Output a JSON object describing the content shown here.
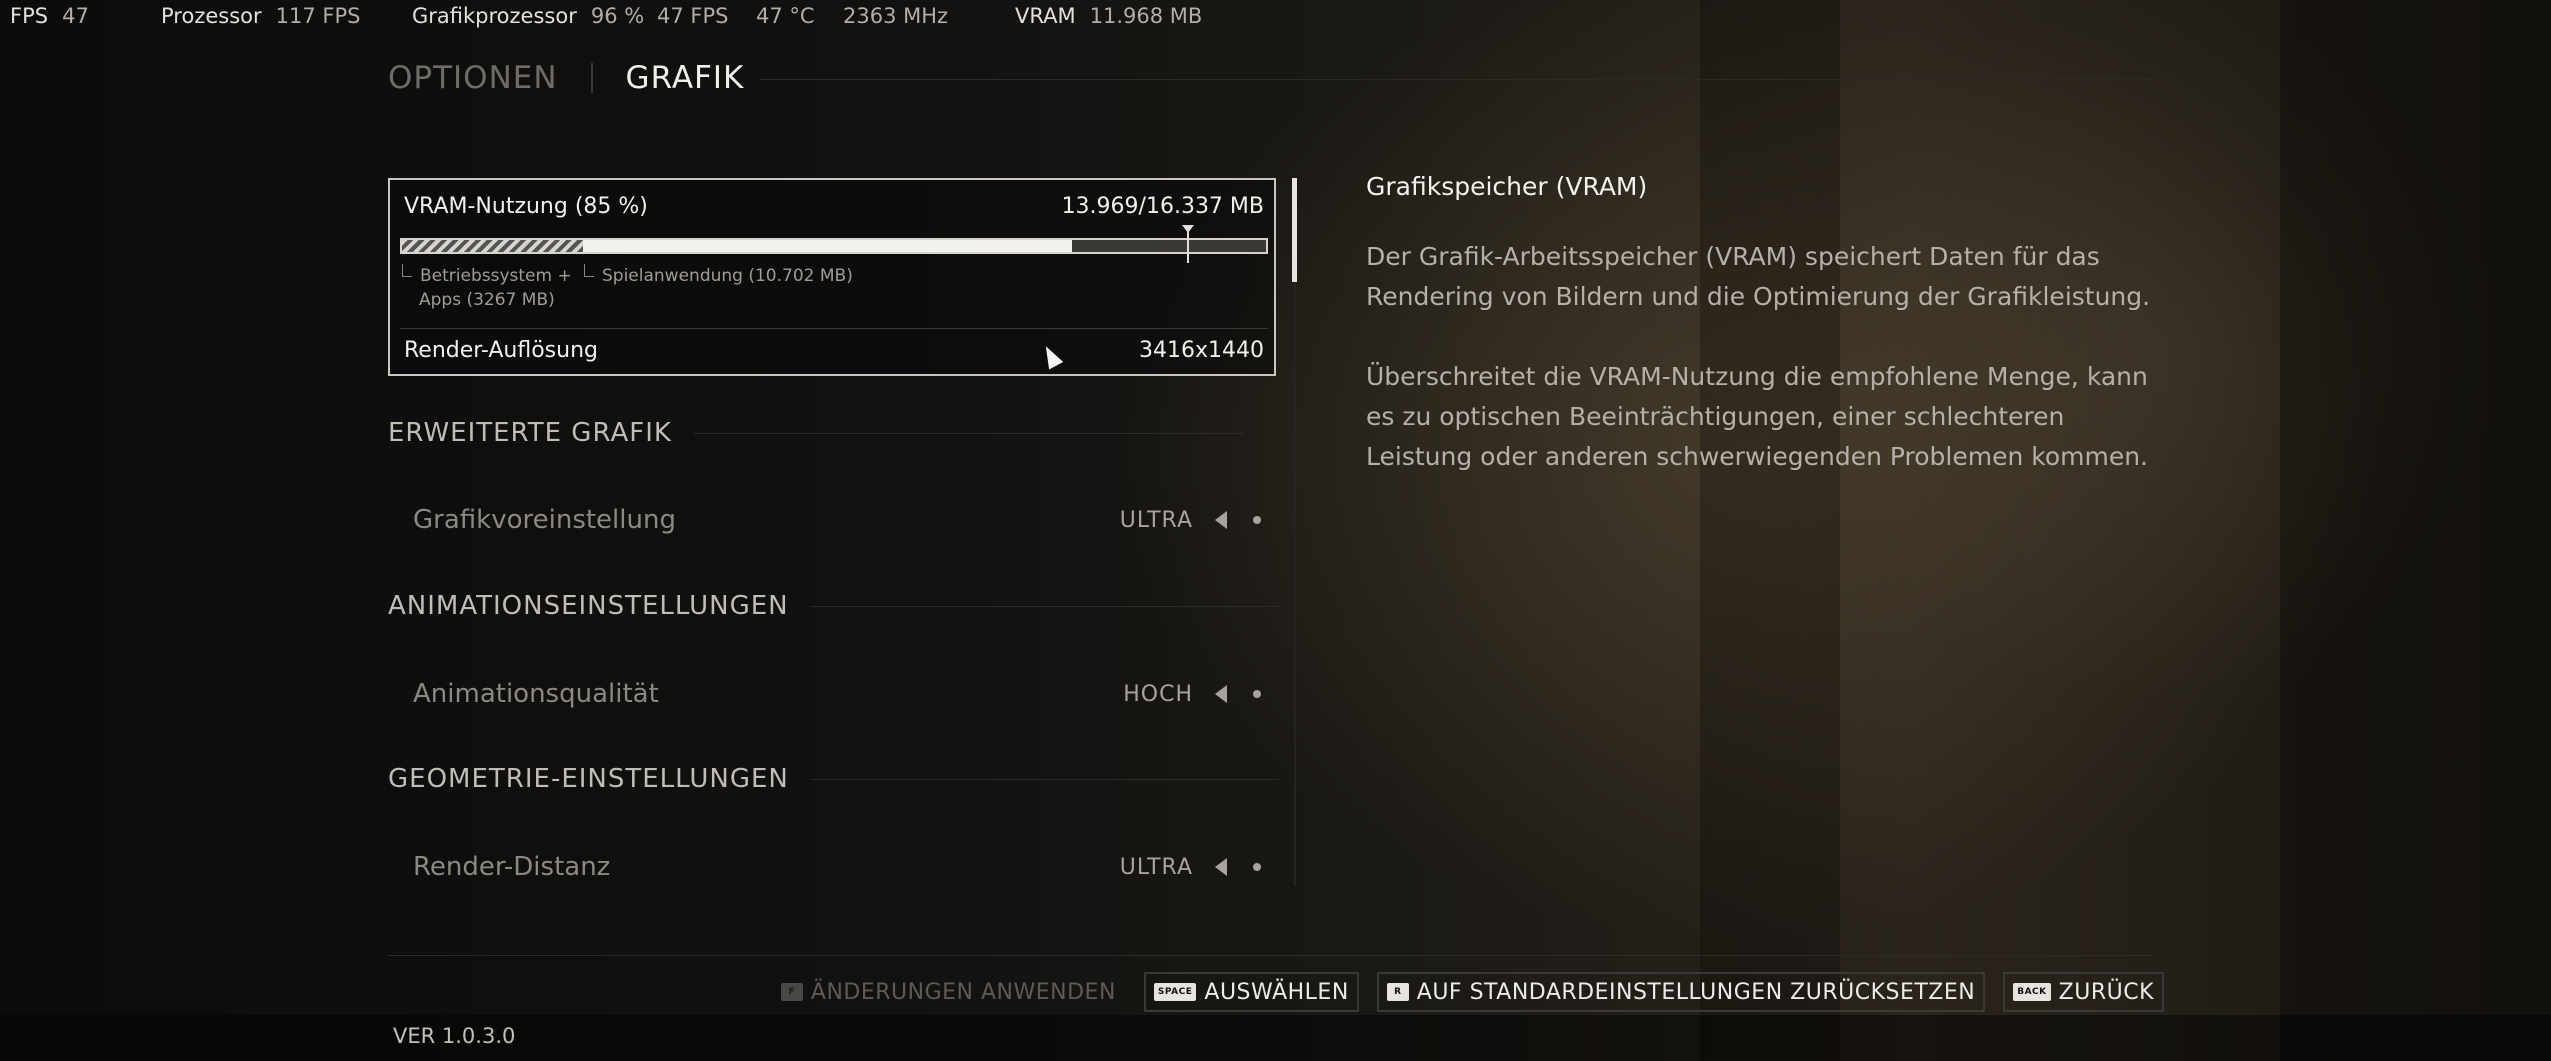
{
  "hud": {
    "fps_label": "FPS",
    "fps_value": "47",
    "cpu_label": "Prozessor",
    "cpu_value": "117 FPS",
    "gpu_label": "Grafikprozessor",
    "gpu_usage": "96 %",
    "gpu_fps": "47 FPS",
    "gpu_temp": "47 °C",
    "gpu_clock": "2363 MHz",
    "vram_label": "VRAM",
    "vram_value": "11.968 MB"
  },
  "tabs": [
    {
      "label": "OPTIONEN",
      "active": false
    },
    {
      "label": "GRAFIK",
      "active": true
    }
  ],
  "vram": {
    "title": "VRAM-Nutzung (85 %)",
    "value": "13.969/16.337 MB",
    "os_fraction": 0.21,
    "game_fraction": 0.565,
    "marker_fraction": 0.91,
    "legend_os_line1": "Betriebssystem +",
    "legend_os_line2": "Apps (3267 MB)",
    "legend_game": "Spielanwendung (10.702 MB)",
    "render_label": "Render-Auflösung",
    "render_value": "3416x1440"
  },
  "sections": [
    {
      "title": "ERWEITERTE GRAFIK",
      "setting": "Grafikvoreinstellung",
      "value": "ULTRA"
    },
    {
      "title": "ANIMATIONSEINSTELLUNGEN",
      "setting": "Animationsqualität",
      "value": "HOCH"
    },
    {
      "title": "GEOMETRIE-EINSTELLUNGEN",
      "setting": "Render-Distanz",
      "value": "ULTRA"
    }
  ],
  "description": {
    "title": "Grafikspeicher (VRAM)",
    "p1": "Der Grafik-Arbeitsspeicher (VRAM) speichert Daten für das Rendering von Bildern und die Optimierung der Grafikleistung.",
    "p2": "Überschreitet die VRAM-Nutzung die empfohlene Menge, kann es zu optischen Beeinträchtigungen, einer schlechteren Leistung oder anderen schwerwiegenden Problemen kommen."
  },
  "buttons": [
    {
      "key": "F",
      "label": "ÄNDERUNGEN ANWENDEN",
      "disabled": true
    },
    {
      "key": "SPACE",
      "label": "AUSWÄHLEN",
      "disabled": false
    },
    {
      "key": "R",
      "label": "AUF STANDARDEINSTELLUNGEN ZURÜCKSETZEN",
      "disabled": false
    },
    {
      "key": "BACK",
      "label": "ZURÜCK",
      "disabled": false
    }
  ],
  "version": "VER 1.0.3.0"
}
